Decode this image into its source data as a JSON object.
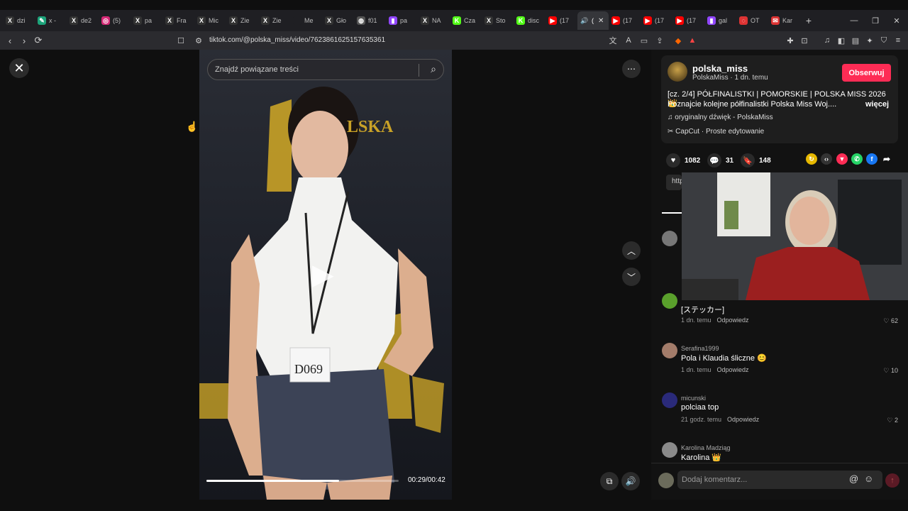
{
  "tabs": [
    {
      "label": "dzi",
      "icon": "x-icon",
      "color": "#333"
    },
    {
      "label": "x -",
      "icon": "chat-icon",
      "color": "#1ca37a"
    },
    {
      "label": "de2",
      "icon": "x-icon",
      "color": "#333"
    },
    {
      "label": "(5)",
      "icon": "instagram-icon",
      "color": "#d62976"
    },
    {
      "label": "pa",
      "icon": "x-icon",
      "color": "#333"
    },
    {
      "label": "Fra",
      "icon": "x-icon",
      "color": "#333"
    },
    {
      "label": "Mic",
      "icon": "x-icon",
      "color": "#333"
    },
    {
      "label": "Zie",
      "icon": "x-icon",
      "color": "#333"
    },
    {
      "label": "Zie",
      "icon": "x-icon",
      "color": "#333"
    },
    {
      "label": "Me",
      "icon": "blank-icon",
      "color": "#1f1f23"
    },
    {
      "label": "Gło",
      "icon": "x-icon",
      "color": "#333"
    },
    {
      "label": "f01",
      "icon": "globe-icon",
      "color": "#555"
    },
    {
      "label": "pa",
      "icon": "twitch-icon",
      "color": "#9146ff"
    },
    {
      "label": "NA",
      "icon": "x-icon",
      "color": "#333"
    },
    {
      "label": "Cza",
      "icon": "kick-icon",
      "color": "#53fc18"
    },
    {
      "label": "Sto",
      "icon": "x-icon",
      "color": "#333"
    },
    {
      "label": "disc",
      "icon": "kick-icon",
      "color": "#53fc18"
    },
    {
      "label": "(17",
      "icon": "youtube-icon",
      "color": "#f00"
    },
    {
      "label": "(",
      "icon": "speaker-icon",
      "color": "#35363a",
      "active": true
    },
    {
      "label": "(17",
      "icon": "youtube-icon",
      "color": "#f00"
    },
    {
      "label": "(17",
      "icon": "youtube-icon",
      "color": "#f00"
    },
    {
      "label": "(17",
      "icon": "youtube-icon",
      "color": "#f00"
    },
    {
      "label": "gal",
      "icon": "twitch-icon",
      "color": "#9146ff"
    },
    {
      "label": "OT",
      "icon": "loading-icon",
      "color": "#d33"
    },
    {
      "label": "Kar",
      "icon": "mail-icon",
      "color": "#d33"
    }
  ],
  "address": {
    "url": "tiktok.com/@polska_miss/video/7623861625157635361"
  },
  "video": {
    "search_placeholder": "Znajdź powiązane treści",
    "time": "00:29/00:42",
    "progress": 0.69,
    "brand_text": "LSKA",
    "tag": "D069"
  },
  "post": {
    "username": "polska_miss",
    "subline": "PolskaMiss · 1 dn. temu",
    "follow": "Obserwuj",
    "desc_line1": "[cz. 2/4] PÓŁFINALISTKI | POMORSKIE | POLSKA MISS 2026 👑",
    "desc_line2": "Poznajcie kolejne półfinalistki Polska Miss Woj....",
    "more": "więcej",
    "sound": "♫  oryginalny dźwięk - PolskaMiss",
    "capcut": "CapCut · Proste edytowanie",
    "likes": "1082",
    "comments": "31",
    "saves": "148",
    "http": "http"
  },
  "comments": [
    {
      "user": "",
      "text": "[ステッカー]",
      "time": "1 dn. temu",
      "reply": "Odpowiedz",
      "likes": "62"
    },
    {
      "user": "Serafina1999",
      "text": "Pola i Klaudia śliczne 😊",
      "time": "1 dn. temu",
      "reply": "Odpowiedz",
      "likes": "10"
    },
    {
      "user": "micunski",
      "text": "polciaa top",
      "time": "21 godz. temu",
      "reply": "Odpowiedz",
      "likes": "2"
    },
    {
      "user": "Karolina Madziąg",
      "text": "Karolina 👑",
      "time": "",
      "reply": "",
      "likes": ""
    }
  ],
  "comment_box": {
    "placeholder": "Dodaj komentarz..."
  }
}
